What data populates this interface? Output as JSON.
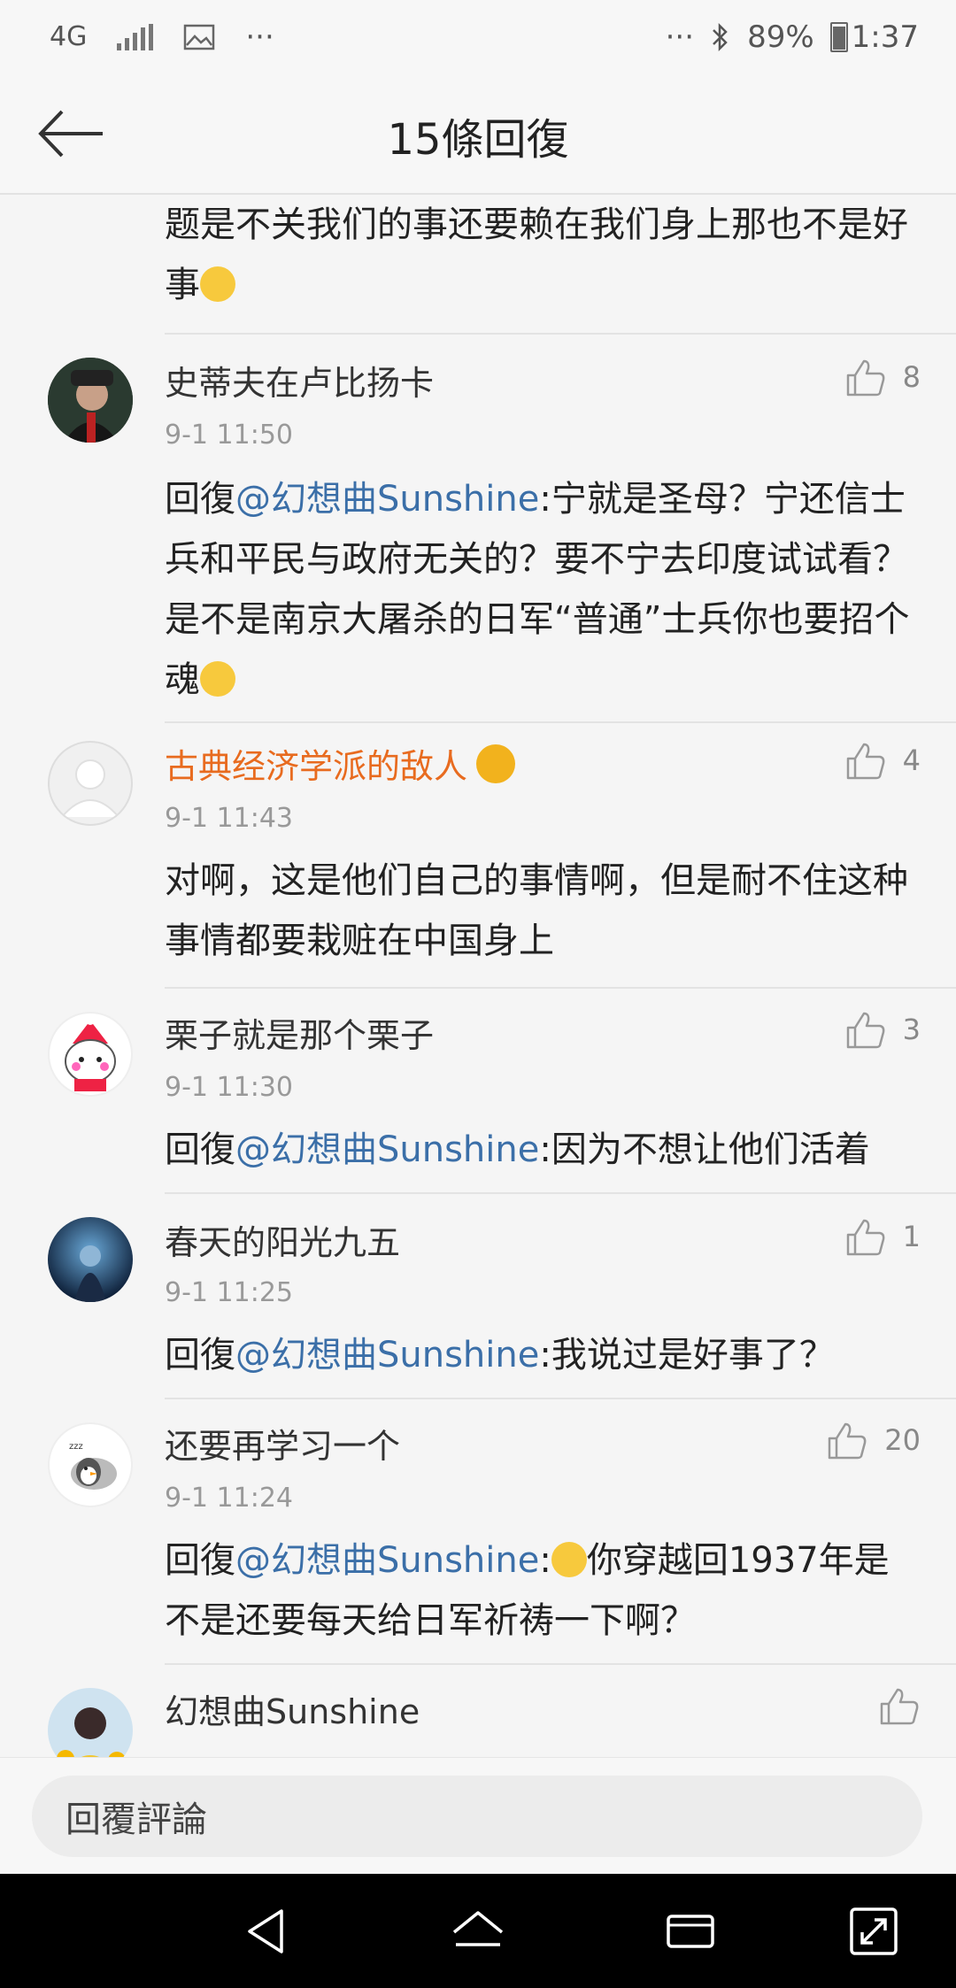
{
  "status_bar": {
    "network": "4G",
    "battery": "89%",
    "time": "1:37",
    "more": "···"
  },
  "header": {
    "title": "15條回復",
    "back_icon": "back-arrow-icon"
  },
  "partial_comment": {
    "text": "题是不关我们的事还要赖在我们身上那也不是好事"
  },
  "comments": [
    {
      "username": "史蒂夫在卢比扬卡",
      "time": "9-1 11:50",
      "likes": "8",
      "reply_prefix": "回復",
      "mention": "@幻想曲Sunshine",
      "text": ":宁就是圣母？宁还信士兵和平民与政府无关的？要不宁去印度试试看？是不是南京大屠杀的日军“普通”士兵你也要招个魂"
    },
    {
      "username": "古典经济学派的敌人",
      "time": "9-1 11:43",
      "likes": "4",
      "text": "对啊，这是他们自己的事情啊，但是耐不住这种事情都要栽赃在中国身上"
    },
    {
      "username": "栗子就是那个栗子",
      "time": "9-1 11:30",
      "likes": "3",
      "reply_prefix": "回復",
      "mention": "@幻想曲Sunshine",
      "text": ":因为不想让他们活着"
    },
    {
      "username": "春天的阳光九五",
      "time": "9-1 11:25",
      "likes": "1",
      "reply_prefix": "回復",
      "mention": "@幻想曲Sunshine",
      "text": ":我说过是好事了？"
    },
    {
      "username": "还要再学习一个",
      "time": "9-1 11:24",
      "likes": "20",
      "reply_prefix": "回復",
      "mention": "@幻想曲Sunshine",
      "text_after_emoji": "你穿越回1937年是不是还要每天给日军祈祷一下啊？",
      "text_before_emoji": ":"
    },
    {
      "username": "幻想曲Sunshine"
    }
  ],
  "reply_bar": {
    "placeholder": "回覆評論"
  },
  "colors": {
    "mention": "#3b6fa8",
    "orange_name": "#e86b1f"
  }
}
